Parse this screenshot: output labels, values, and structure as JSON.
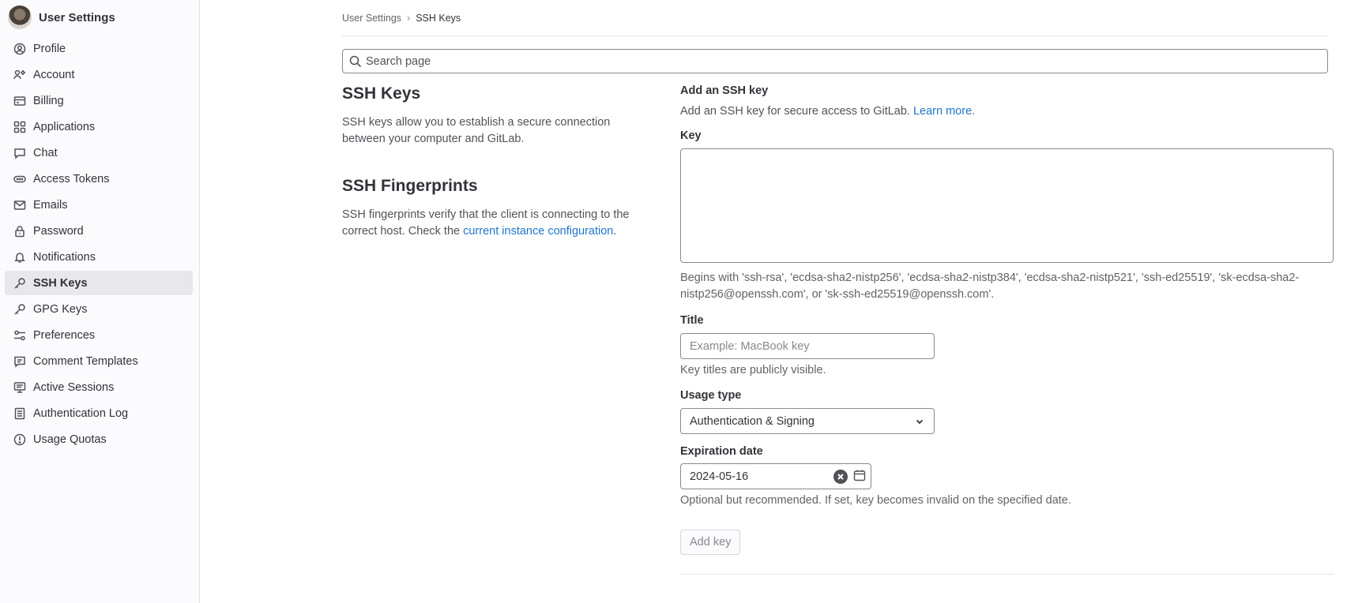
{
  "sidebar": {
    "title": "User Settings",
    "items": [
      {
        "label": "Profile",
        "icon": "profile-icon"
      },
      {
        "label": "Account",
        "icon": "account-icon"
      },
      {
        "label": "Billing",
        "icon": "billing-icon"
      },
      {
        "label": "Applications",
        "icon": "applications-icon"
      },
      {
        "label": "Chat",
        "icon": "chat-icon"
      },
      {
        "label": "Access Tokens",
        "icon": "token-icon"
      },
      {
        "label": "Emails",
        "icon": "mail-icon"
      },
      {
        "label": "Password",
        "icon": "lock-icon"
      },
      {
        "label": "Notifications",
        "icon": "bell-icon"
      },
      {
        "label": "SSH Keys",
        "icon": "key-icon",
        "active": true
      },
      {
        "label": "GPG Keys",
        "icon": "key-icon"
      },
      {
        "label": "Preferences",
        "icon": "preferences-icon"
      },
      {
        "label": "Comment Templates",
        "icon": "comment-icon"
      },
      {
        "label": "Active Sessions",
        "icon": "monitor-icon"
      },
      {
        "label": "Authentication Log",
        "icon": "log-icon"
      },
      {
        "label": "Usage Quotas",
        "icon": "quota-icon"
      }
    ]
  },
  "breadcrumb": {
    "parent": "User Settings",
    "separator": "›",
    "current": "SSH Keys"
  },
  "search": {
    "placeholder": "Search page"
  },
  "left": {
    "ssh_title": "SSH Keys",
    "ssh_desc": "SSH keys allow you to establish a secure connection between your computer and GitLab.",
    "fp_title": "SSH Fingerprints",
    "fp_desc_before": "SSH fingerprints verify that the client is connecting to the correct host. Check the ",
    "fp_link": "current instance configuration",
    "fp_desc_after": "."
  },
  "form": {
    "heading": "Add an SSH key",
    "intro": "Add an SSH key for secure access to GitLab. ",
    "intro_link": "Learn more.",
    "key_label": "Key",
    "key_value": "",
    "key_help": "Begins with 'ssh-rsa', 'ecdsa-sha2-nistp256', 'ecdsa-sha2-nistp384', 'ecdsa-sha2-nistp521', 'ssh-ed25519', 'sk-ecdsa-sha2-nistp256@openssh.com', or 'sk-ssh-ed25519@openssh.com'.",
    "title_label": "Title",
    "title_placeholder": "Example: MacBook key",
    "title_help": "Key titles are publicly visible.",
    "usage_label": "Usage type",
    "usage_value": "Authentication & Signing",
    "expiration_label": "Expiration date",
    "expiration_value": "2024-05-16",
    "expiration_help": "Optional but recommended. If set, key becomes invalid on the specified date.",
    "submit_label": "Add key"
  },
  "colors": {
    "link": "#1f75cb",
    "sidebar_bg": "#fbfafd",
    "active_item_bg": "#e8e7ec"
  }
}
